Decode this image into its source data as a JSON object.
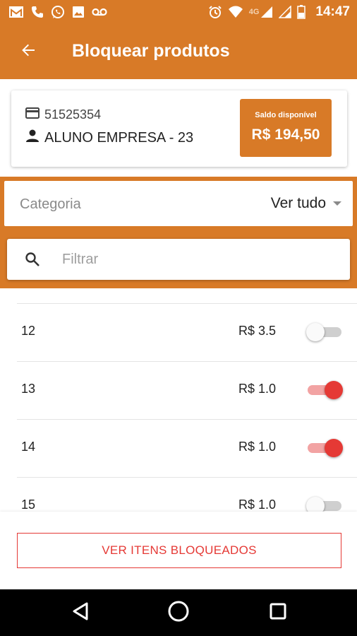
{
  "status_bar": {
    "time": "14:47",
    "network": "4G",
    "left_icons": [
      "gmail-icon",
      "phone-icon",
      "whatsapp-icon",
      "gallery-icon",
      "voicemail-icon"
    ],
    "right_icons": [
      "alarm-icon",
      "wifi-icon",
      "signal-icon",
      "signal-icon",
      "battery-icon"
    ]
  },
  "header": {
    "title": "Bloquear produtos",
    "back_icon": "arrow-back-icon"
  },
  "account": {
    "card_number": "51525354",
    "student_name": "ALUNO EMPRESA - 23",
    "balance_label": "Saldo disponível",
    "balance_value": "R$ 194,50"
  },
  "filters": {
    "category_label": "Categoria",
    "category_value": "Ver tudo",
    "search_placeholder": "Filtrar",
    "search_value": ""
  },
  "products": [
    {
      "id": "12",
      "price": "R$ 3.5",
      "blocked": false
    },
    {
      "id": "13",
      "price": "R$ 1.0",
      "blocked": true
    },
    {
      "id": "14",
      "price": "R$ 1.0",
      "blocked": true
    },
    {
      "id": "15",
      "price": "R$ 1.0",
      "blocked": false
    }
  ],
  "actions": {
    "view_blocked_label": "VER ITENS BLOQUEADOS"
  },
  "colors": {
    "primary": "#d87a27",
    "accent": "#e53935",
    "switch_on_track": "#f2a3a3",
    "switch_off_track": "#cfcfcf"
  }
}
